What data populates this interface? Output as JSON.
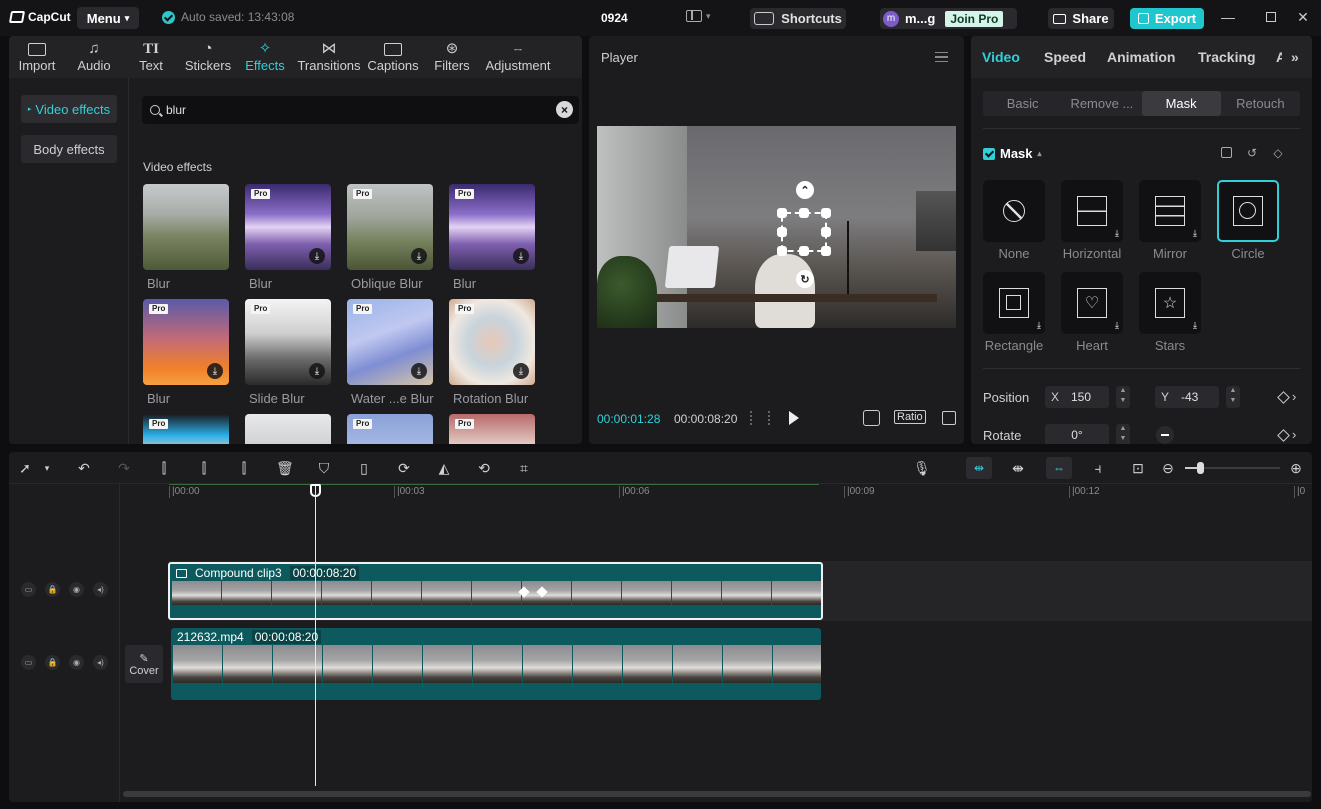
{
  "app": {
    "logo_text": "CapCut",
    "menu_label": "Menu",
    "autosave_text": "Auto saved: 13:43:08",
    "project_name": "0924",
    "shortcuts_label": "Shortcuts",
    "user_initial": "m",
    "user_name": "m...g",
    "join_pro_label": "Join Pro",
    "share_label": "Share",
    "export_label": "Export",
    "accent_color": "#31d0d8"
  },
  "toolbar": {
    "tabs": [
      {
        "label": "Import",
        "icon": "import-icon"
      },
      {
        "label": "Audio",
        "icon": "audio-icon"
      },
      {
        "label": "Text",
        "icon": "text-icon"
      },
      {
        "label": "Stickers",
        "icon": "stickers-icon"
      },
      {
        "label": "Effects",
        "icon": "effects-icon",
        "active": true
      },
      {
        "label": "Transitions",
        "icon": "transitions-icon"
      },
      {
        "label": "Captions",
        "icon": "captions-icon"
      },
      {
        "label": "Filters",
        "icon": "filters-icon"
      },
      {
        "label": "Adjustment",
        "icon": "adjustment-icon"
      }
    ]
  },
  "effects_panel": {
    "categories": [
      {
        "label": "Video effects",
        "active": true
      },
      {
        "label": "Body effects"
      }
    ],
    "search_value": "blur",
    "section_title": "Video effects",
    "items": [
      {
        "name": "Blur",
        "pro": false,
        "download": false
      },
      {
        "name": "Blur",
        "pro": true,
        "download": true
      },
      {
        "name": "Oblique Blur",
        "pro": true,
        "download": true
      },
      {
        "name": "Blur",
        "pro": true,
        "download": true
      },
      {
        "name": "Blur",
        "pro": true,
        "download": true
      },
      {
        "name": "Slide Blur",
        "pro": true,
        "download": true
      },
      {
        "name": "Water ...e Blur",
        "pro": true,
        "download": true
      },
      {
        "name": "Rotation Blur",
        "pro": true,
        "download": true
      },
      {
        "name": "",
        "pro": true,
        "download": false
      },
      {
        "name": "",
        "pro": false,
        "download": false
      },
      {
        "name": "",
        "pro": true,
        "download": false
      },
      {
        "name": "",
        "pro": true,
        "download": false
      }
    ],
    "pro_badge": "Pro"
  },
  "player": {
    "title": "Player",
    "current_time": "00:00:01:28",
    "total_time": "00:00:08:20",
    "ratio_label": "Ratio"
  },
  "properties": {
    "tabs": [
      "Video",
      "Speed",
      "Animation",
      "Tracking",
      "A"
    ],
    "sub_tabs": [
      "Basic",
      "Remove ...",
      "Mask",
      "Retouch"
    ],
    "active_sub_tab": "Mask",
    "mask_title": "Mask",
    "masks": [
      {
        "label": "None"
      },
      {
        "label": "Horizontal"
      },
      {
        "label": "Mirror"
      },
      {
        "label": "Circle",
        "selected": true
      },
      {
        "label": "Rectangle"
      },
      {
        "label": "Heart"
      },
      {
        "label": "Stars"
      }
    ],
    "position_label": "Position",
    "x_axis": "X",
    "x_value": "150",
    "y_axis": "Y",
    "y_value": "-43",
    "rotate_label": "Rotate",
    "rotate_value": "0°"
  },
  "timeline": {
    "ruler": [
      "|00:00",
      "|00:03",
      "|00:06",
      "|00:09",
      "|00:12",
      "|0"
    ],
    "cover_label": "Cover",
    "clips": [
      {
        "name": "Compound clip3",
        "duration": "00:00:08:20"
      },
      {
        "name": "212632.mp4",
        "duration": "00:00:08:20"
      }
    ]
  }
}
